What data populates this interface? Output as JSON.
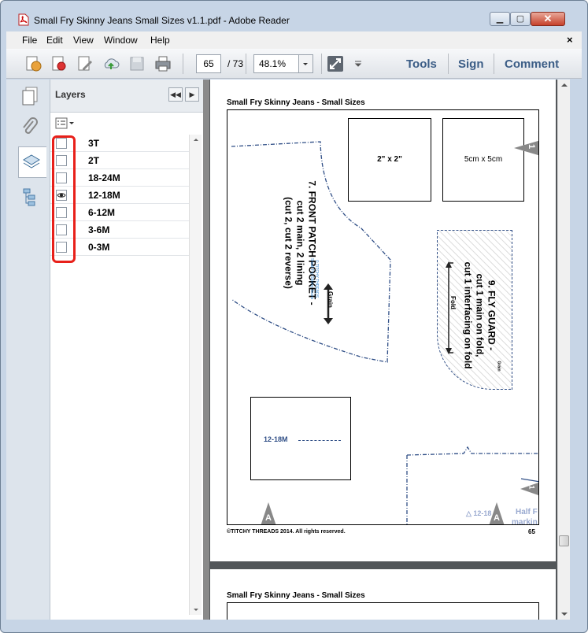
{
  "window": {
    "title": "Small Fry Skinny Jeans Small Sizes v1.1.pdf - Adobe Reader",
    "min_glyph": "▁",
    "max_glyph": "▢",
    "close_glyph": "✕"
  },
  "menubar": {
    "items": [
      "File",
      "Edit",
      "View",
      "Window",
      "Help"
    ],
    "close_glyph": "×"
  },
  "toolbar": {
    "page_value": "65",
    "page_total": "/ 73",
    "zoom_value": "48.1%",
    "links": [
      "Tools",
      "Sign",
      "Comment"
    ]
  },
  "panel": {
    "title": "Layers",
    "collapse_glyph": "◀◀",
    "expand_glyph": "▶",
    "layers": [
      {
        "label": "3T",
        "visible": false
      },
      {
        "label": "2T",
        "visible": false
      },
      {
        "label": "18-24M",
        "visible": false
      },
      {
        "label": "12-18M",
        "visible": true
      },
      {
        "label": "6-12M",
        "visible": false
      },
      {
        "label": "3-6M",
        "visible": false
      },
      {
        "label": "0-3M",
        "visible": false
      }
    ]
  },
  "document": {
    "page_header": "Small Fry Skinny Jeans - Small Sizes",
    "page2_header": "Small Fry Skinny Jeans - Small Sizes",
    "box_small_label": "2\" x 2\"",
    "box_metric_label": "5cm x 5cm",
    "pocket_title": "7. FRONT PATCH POCKET -",
    "pocket_line2": "cut 2 main, 2 lining",
    "pocket_line3": "(cut 2, cut 2 reverse)",
    "brand1": "© TITCHY THREADS",
    "brand2": "Small Fry Skinny Jeans",
    "grain": "Grain",
    "fly_title": "9. FLY GUARD -",
    "fly_line2": "cut 1 main on fold,",
    "fly_line3": "cut 1 interfacing on fold",
    "fold": "Fold",
    "size_label": "12-18M",
    "marker_a": "A",
    "marker_1": "1",
    "half_text": "Half F",
    "mark_text": "markin",
    "triangle_size": "12-18",
    "copyright": "©TITCHY THREADS 2014. All rights reserved.",
    "page_number": "65"
  }
}
